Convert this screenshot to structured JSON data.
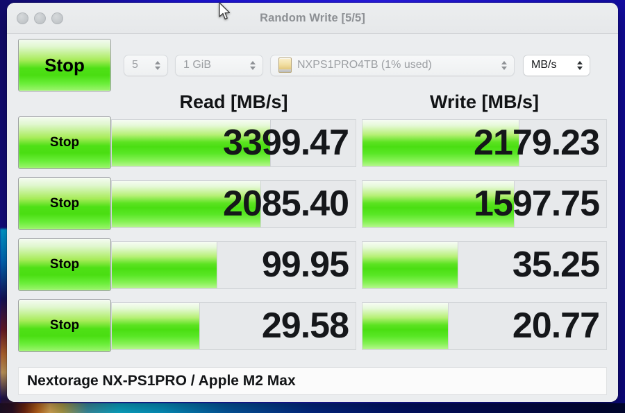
{
  "window": {
    "title": "Random Write [5/5]",
    "traffic_lights": [
      "close-button",
      "minimize-button",
      "zoom-button"
    ]
  },
  "toolbar": {
    "run_button_label": "Stop",
    "loop_count": "5",
    "test_size": "1 GiB",
    "target_drive": "NXPS1PRO4TB (1% used)",
    "unit": "MB/s",
    "drive_icon": "drive-icon"
  },
  "columns": {
    "read": "Read [MB/s]",
    "write": "Write [MB/s]"
  },
  "rows": [
    {
      "button_label": "Stop",
      "read_value": "3399.47",
      "read_fill_pct": 65,
      "write_value": "2179.23",
      "write_fill_pct": 64
    },
    {
      "button_label": "Stop",
      "read_value": "2085.40",
      "read_fill_pct": 61,
      "write_value": "1597.75",
      "write_fill_pct": 62
    },
    {
      "button_label": "Stop",
      "read_value": "99.95",
      "read_fill_pct": 43,
      "write_value": "35.25",
      "write_fill_pct": 39
    },
    {
      "button_label": "Stop",
      "read_value": "29.58",
      "read_fill_pct": 36,
      "write_value": "20.77",
      "write_fill_pct": 35
    }
  ],
  "status": {
    "text": "Nextorage NX-PS1PRO / Apple M2 Max"
  },
  "colors": {
    "accent_green": "#4ade12",
    "window_bg": "#ebedef",
    "desktop_blue": "#1a12c8"
  }
}
